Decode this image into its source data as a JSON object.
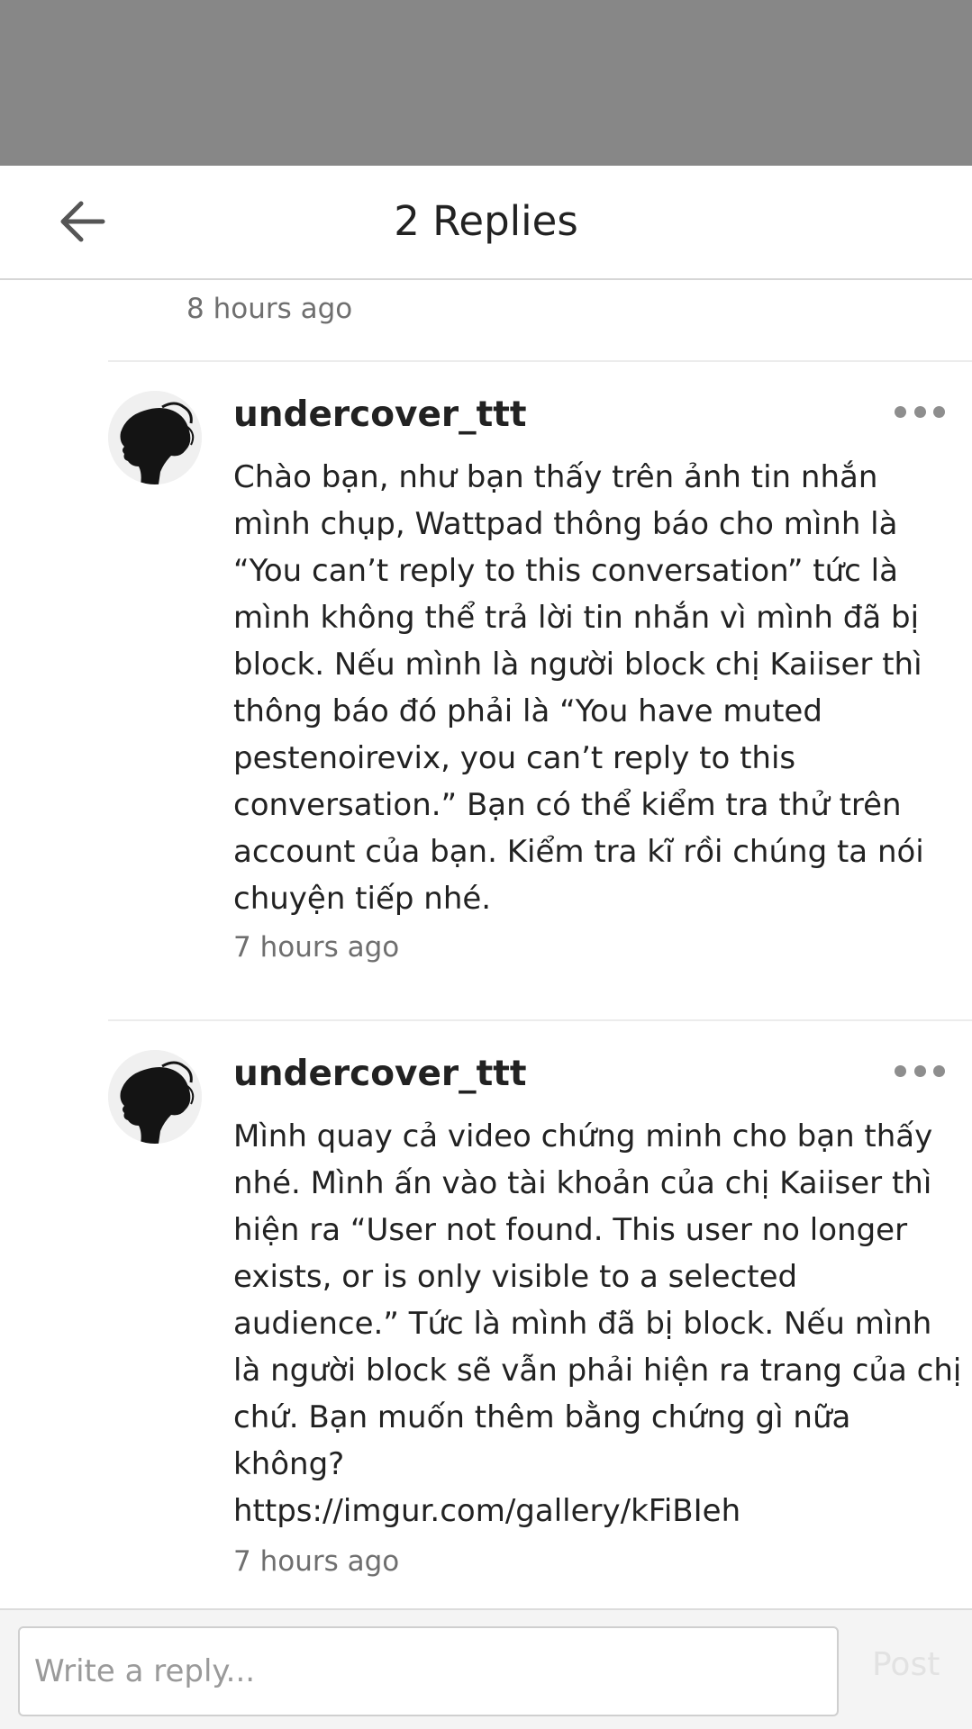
{
  "header": {
    "title": "2 Replies",
    "back_icon": "arrow-left-icon"
  },
  "previous_comment": {
    "timestamp": "8 hours ago"
  },
  "replies": [
    {
      "username": "undercover_ttt",
      "avatar_icon": "user-avatar",
      "more_icon": "more-horizontal-icon",
      "lines": [
        "Chào bạn, như bạn thấy trên ảnh tin nhắn",
        "mình chụp, Wattpad thông báo cho mình là",
        "“You can’t reply to this conversation” tức là",
        "mình không thể trả lời tin nhắn vì mình đã bị",
        "block. Nếu mình là người block chị Kaiiser thì",
        "thông báo đó phải là “You have muted",
        "pestenoirevix, you can’t reply to this",
        "conversation.” Bạn có thể kiểm tra thử trên",
        "account của bạn. Kiểm tra kĩ rồi chúng ta nói",
        "chuyện tiếp nhé."
      ],
      "timestamp": "7 hours ago"
    },
    {
      "username": "undercover_ttt",
      "avatar_icon": "user-avatar",
      "more_icon": "more-horizontal-icon",
      "lines": [
        "Mình quay cả video chứng minh cho bạn thấy",
        "nhé. Mình ấn vào tài khoản của chị Kaiiser thì",
        "hiện ra “User not found. This user no longer",
        "exists, or is only visible to a selected",
        "audience.” Tức là mình đã bị block. Nếu mình",
        "là người block sẽ vẫn phải hiện ra trang của chị",
        "chứ. Bạn muốn thêm bằng chứng gì nữa",
        "không?",
        "https://imgur.com/gallery/kFiBIeh"
      ],
      "timestamp": "7 hours ago"
    }
  ],
  "compose": {
    "placeholder": "Write a reply...",
    "value": "",
    "post_label": "Post"
  },
  "colors": {
    "overlay": "#878787",
    "text": "#222222",
    "muted_text": "#6f6f6f",
    "post_disabled": "#e2e2e2"
  }
}
